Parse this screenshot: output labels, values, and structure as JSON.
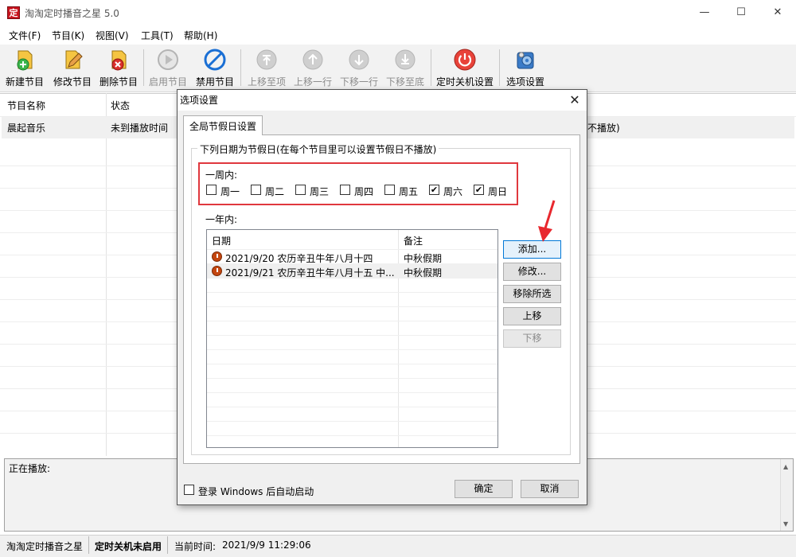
{
  "app": {
    "title": "淘淘定时播音之星 5.0",
    "icon_text": "定",
    "window_controls": {
      "minimize": "—",
      "maximize": "☐",
      "close": "✕"
    }
  },
  "menu": [
    "文件(F)",
    "节目(K)",
    "视图(V)",
    "工具(T)",
    "帮助(H)"
  ],
  "toolbar": [
    {
      "label": "新建节目",
      "icon": "new-program-icon",
      "enabled": true
    },
    {
      "label": "修改节目",
      "icon": "edit-program-icon",
      "enabled": true
    },
    {
      "label": "删除节目",
      "icon": "delete-program-icon",
      "enabled": true
    },
    {
      "label": "启用节目",
      "icon": "enable-program-icon",
      "enabled": false
    },
    {
      "label": "禁用节目",
      "icon": "disable-program-icon",
      "enabled": true
    },
    {
      "label": "上移至项",
      "icon": "move-top-icon",
      "enabled": false
    },
    {
      "label": "上移一行",
      "icon": "move-up-icon",
      "enabled": false
    },
    {
      "label": "下移一行",
      "icon": "move-down-icon",
      "enabled": false
    },
    {
      "label": "下移至底",
      "icon": "move-bottom-icon",
      "enabled": false
    },
    {
      "label": "定时关机设置",
      "icon": "power-icon",
      "enabled": true
    },
    {
      "label": "选项设置",
      "icon": "settings-icon",
      "enabled": true
    }
  ],
  "program_list": {
    "headers": [
      "节目名称",
      "状态"
    ],
    "rows": [
      {
        "name": "晨起音乐",
        "status": "未到播放时间",
        "tail": "不播放)"
      }
    ]
  },
  "now_playing": {
    "label": "正在播放:"
  },
  "statusbar": {
    "app_name": "淘淘定时播音之星",
    "shutdown": "定时关机未启用",
    "time_label": "当前时间:",
    "time_value": "2021/9/9 11:29:06"
  },
  "dialog": {
    "title": "选项设置",
    "close": "✕",
    "tab": "全局节假日设置",
    "group_title": "下列日期为节假日(在每个节目里可以设置节假日不播放)",
    "week_label": "一周内:",
    "weekdays": [
      {
        "label": "周一",
        "checked": false
      },
      {
        "label": "周二",
        "checked": false
      },
      {
        "label": "周三",
        "checked": false
      },
      {
        "label": "周四",
        "checked": false
      },
      {
        "label": "周五",
        "checked": false
      },
      {
        "label": "周六",
        "checked": true
      },
      {
        "label": "周日",
        "checked": true
      }
    ],
    "year_label": "一年内:",
    "date_list": {
      "headers": [
        "日期",
        "备注"
      ],
      "rows": [
        {
          "date": "2021/9/20 农历辛丑牛年八月十四",
          "note": "中秋假期"
        },
        {
          "date": "2021/9/21 农历辛丑牛年八月十五 中...",
          "note": "中秋假期"
        }
      ]
    },
    "buttons": {
      "add": "添加...",
      "edit": "修改...",
      "remove": "移除所选",
      "up": "上移",
      "down": "下移"
    },
    "autostart": {
      "label": "登录 Windows 后自动启动",
      "checked": false
    },
    "ok": "确定",
    "cancel": "取消"
  },
  "colors": {
    "highlight_box": "#e0383e",
    "arrow": "#e8282e",
    "accent": "#0078d7"
  }
}
